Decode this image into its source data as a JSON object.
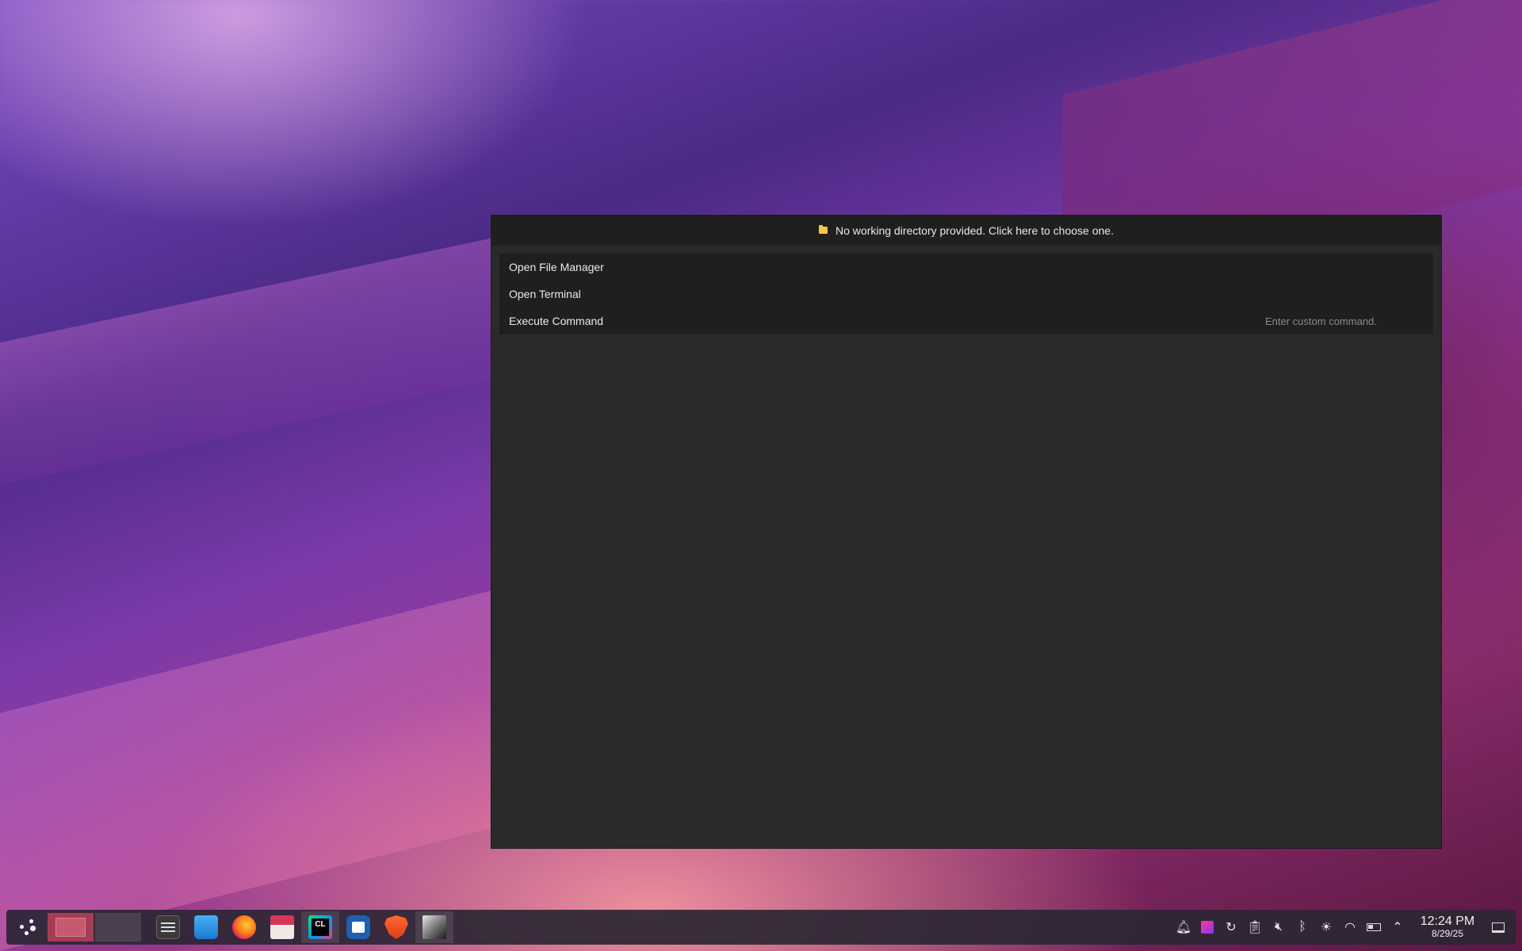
{
  "dialog": {
    "directory_prompt": "No working directory provided. Click here to choose one.",
    "actions": [
      {
        "label": "Open File Manager"
      },
      {
        "label": "Open Terminal"
      },
      {
        "label": "Execute Command"
      }
    ],
    "command_placeholder": "Enter custom command."
  },
  "taskbar": {
    "apps": [
      {
        "name": "system-settings-icon"
      },
      {
        "name": "software-store-icon"
      },
      {
        "name": "firefox-icon"
      },
      {
        "name": "file-manager-icon"
      },
      {
        "name": "clion-icon",
        "badge": "CL"
      },
      {
        "name": "notes-app-icon"
      },
      {
        "name": "brave-browser-icon"
      },
      {
        "name": "image-viewer-icon"
      }
    ],
    "clock": {
      "time": "12:24 PM",
      "date": "8/29/25"
    }
  },
  "colors": {
    "accent": "#a63c55",
    "dialog_bg": "#2a2a2a",
    "folder": "#f0c84a"
  }
}
